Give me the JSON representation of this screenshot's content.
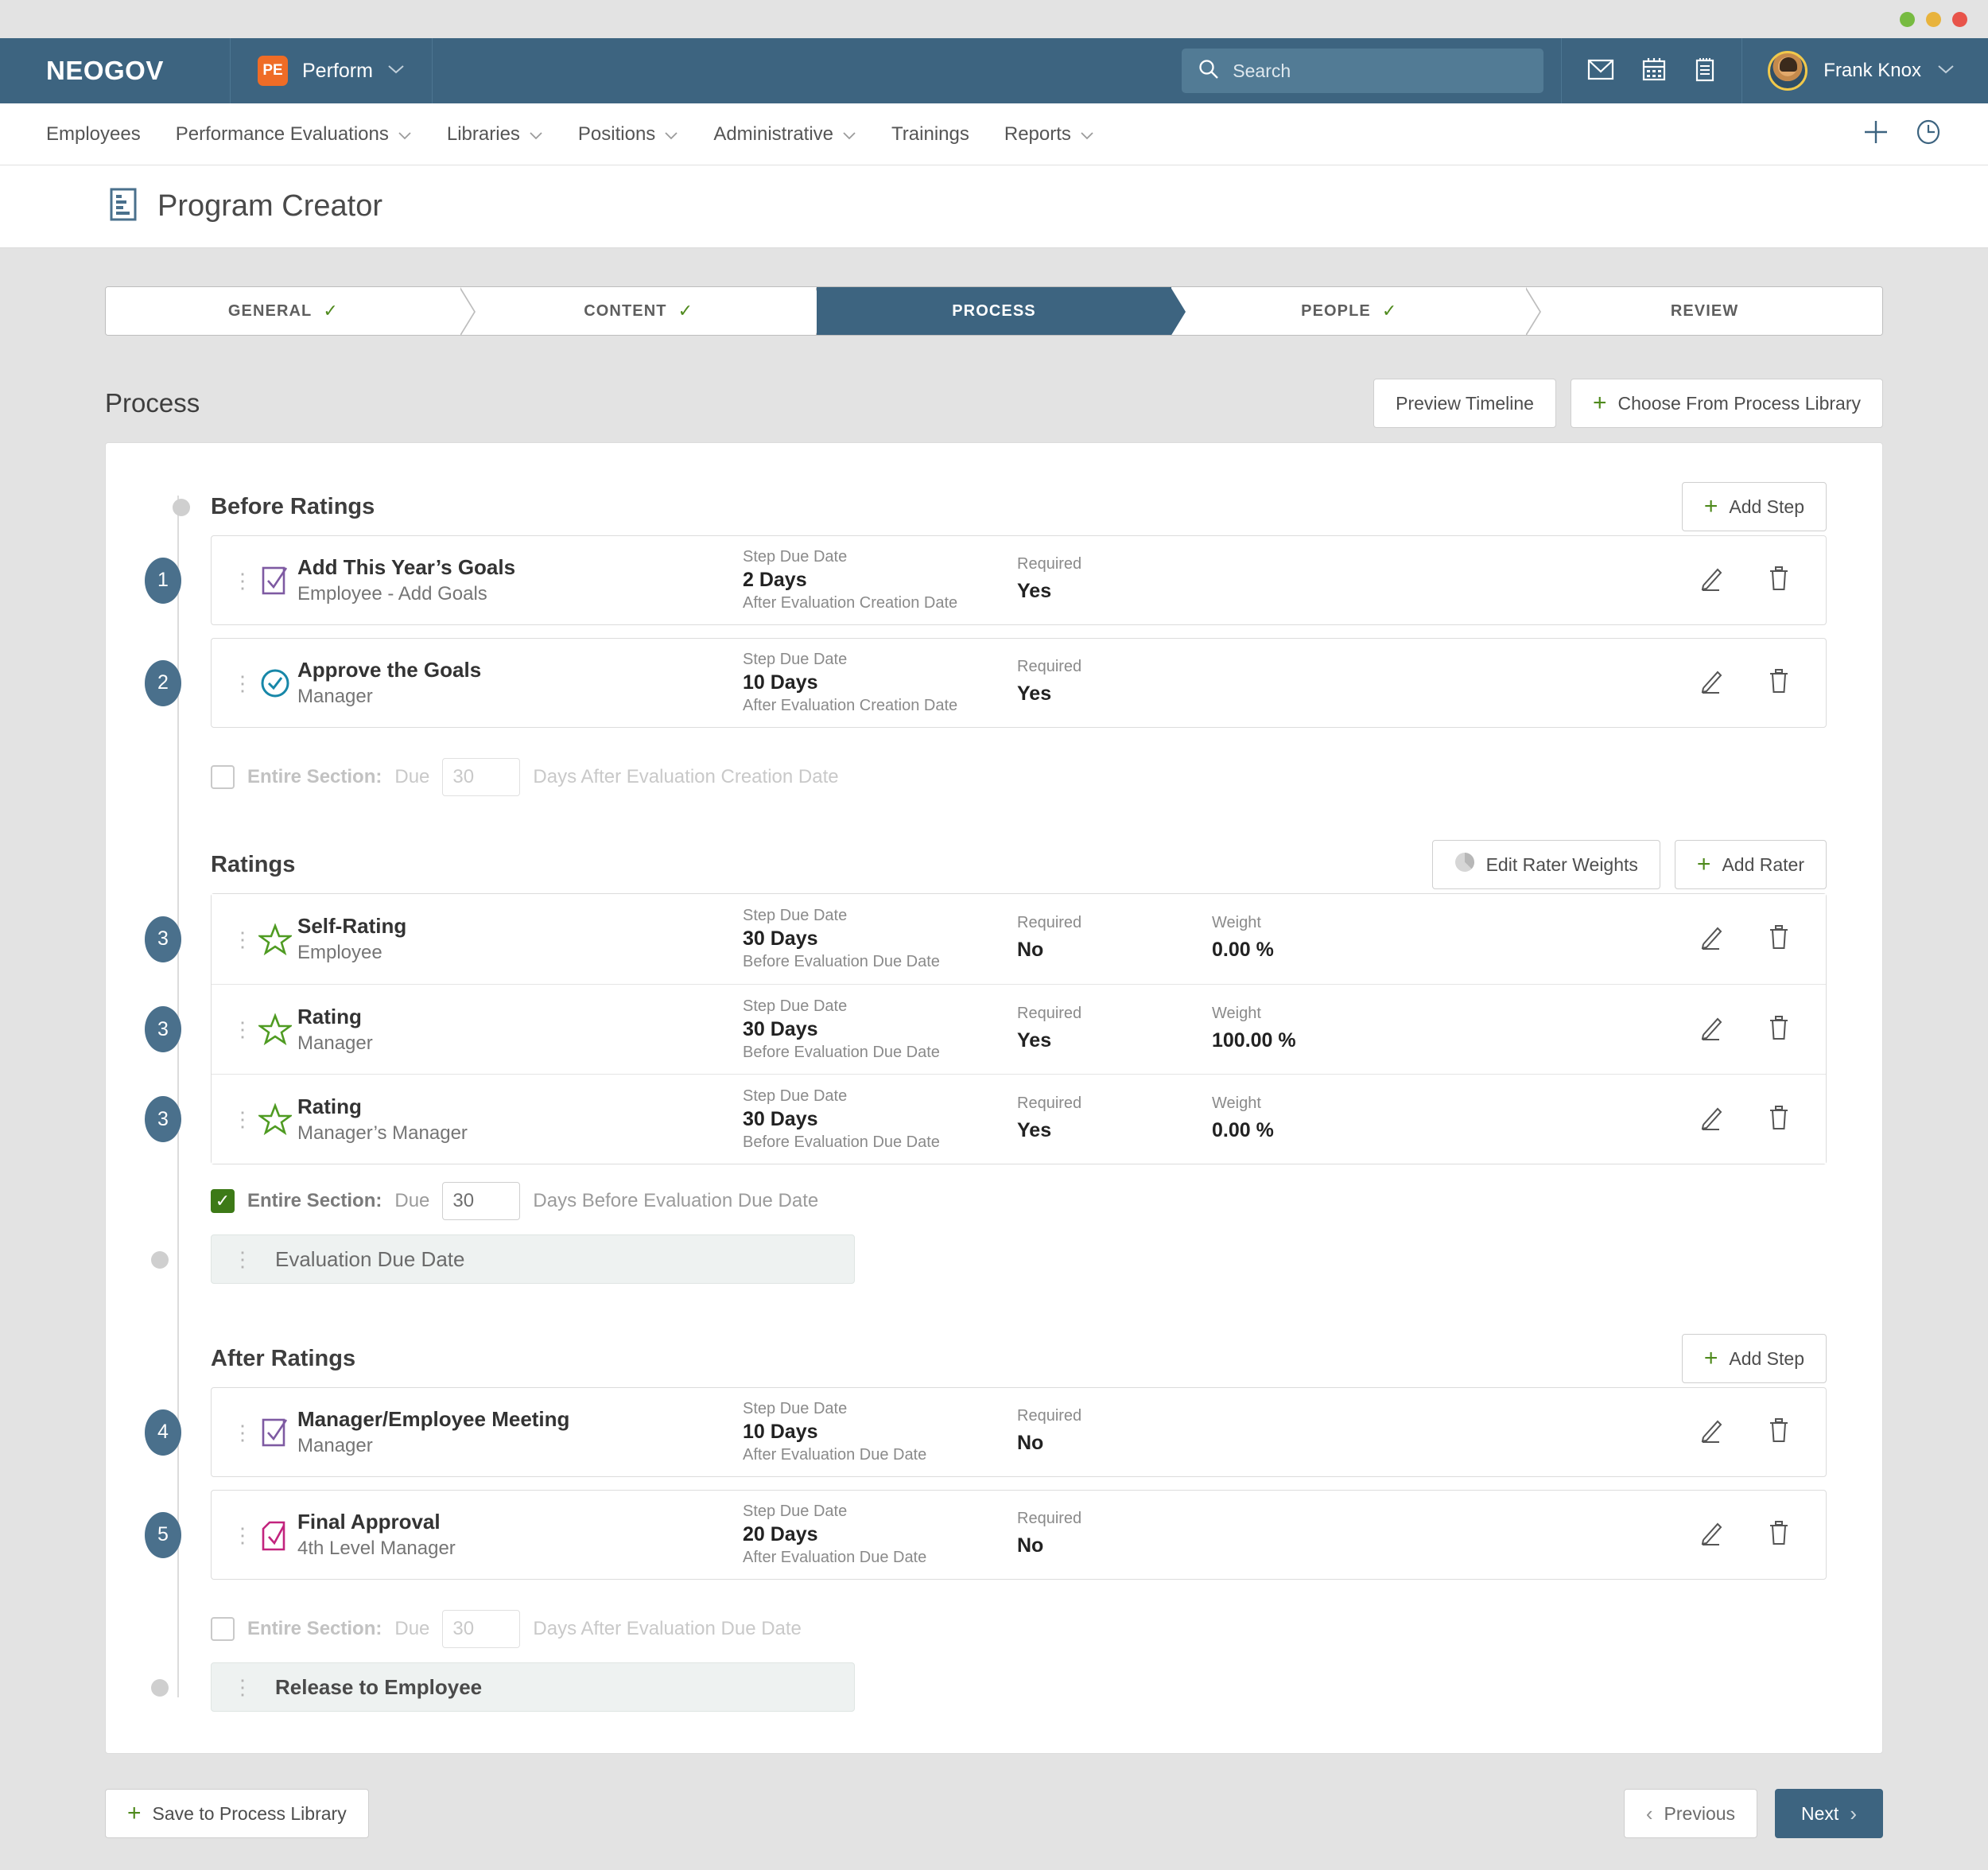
{
  "window": {
    "dots": [
      "green",
      "yellow",
      "red"
    ]
  },
  "topnav": {
    "brand": "NEOGOV",
    "app_badge": "PE",
    "app_name": "Perform",
    "search_placeholder": "Search",
    "search_value": "",
    "icons": [
      "envelope-icon",
      "calendar-icon",
      "notepad-icon"
    ],
    "user_name": "Frank Knox"
  },
  "subnav": {
    "items": [
      {
        "label": "Employees",
        "has_caret": false
      },
      {
        "label": "Performance Evaluations",
        "has_caret": true
      },
      {
        "label": "Libraries",
        "has_caret": true
      },
      {
        "label": "Positions",
        "has_caret": true
      },
      {
        "label": "Administrative",
        "has_caret": true
      },
      {
        "label": "Trainings",
        "has_caret": false
      },
      {
        "label": "Reports",
        "has_caret": true
      }
    ],
    "right_icons": [
      "plus-icon",
      "clock-icon"
    ]
  },
  "page": {
    "title": "Program Creator",
    "title_icon": "document-lines-icon"
  },
  "wizard": {
    "steps": [
      {
        "label": "GENERAL",
        "done": true,
        "active": false
      },
      {
        "label": "CONTENT",
        "done": true,
        "active": false
      },
      {
        "label": "PROCESS",
        "done": false,
        "active": true
      },
      {
        "label": "PEOPLE",
        "done": true,
        "active": false
      },
      {
        "label": "REVIEW",
        "done": false,
        "active": false
      }
    ]
  },
  "process": {
    "heading": "Process",
    "preview_timeline_label": "Preview Timeline",
    "choose_library_label": "Choose From Process Library",
    "sections": [
      {
        "title": "Before Ratings",
        "action_label": "Add Step",
        "steps": [
          {
            "badge": "1",
            "name": "Add This Year’s Goals",
            "role": "Employee - Add Goals",
            "icon": "checkbox-purple-icon",
            "due_label": "Step Due Date",
            "due_value": "2 Days",
            "due_sub": "After Evaluation Creation Date",
            "required_label": "Required",
            "required_value": "Yes"
          },
          {
            "badge": "2",
            "name": "Approve the Goals",
            "role": "Manager",
            "icon": "check-circle-teal-icon",
            "due_label": "Step Due Date",
            "due_value": "10 Days",
            "due_sub": "After Evaluation Creation Date",
            "required_label": "Required",
            "required_value": "Yes"
          }
        ],
        "entire_section": {
          "checked": false,
          "label": "Entire Section:",
          "due_word": "Due",
          "days": "30",
          "tail": "Days After Evaluation Creation Date"
        }
      },
      {
        "title": "Ratings",
        "edit_weights_label": "Edit Rater Weights",
        "add_rater_label": "Add Rater",
        "steps": [
          {
            "badge": "3",
            "name": "Self-Rating",
            "role": "Employee",
            "icon": "star-green-icon",
            "due_label": "Step Due Date",
            "due_value": "30 Days",
            "due_sub": "Before Evaluation Due Date",
            "required_label": "Required",
            "required_value": "No",
            "weight_label": "Weight",
            "weight_value": "0.00 %"
          },
          {
            "badge": "3",
            "name": "Rating",
            "role": "Manager",
            "icon": "star-green-icon",
            "due_label": "Step Due Date",
            "due_value": "30 Days",
            "due_sub": "Before Evaluation Due Date",
            "required_label": "Required",
            "required_value": "Yes",
            "weight_label": "Weight",
            "weight_value": "100.00 %"
          },
          {
            "badge": "3",
            "name": "Rating",
            "role": "Manager’s Manager",
            "icon": "star-green-icon",
            "due_label": "Step Due Date",
            "due_value": "30 Days",
            "due_sub": "Before Evaluation Due Date",
            "required_label": "Required",
            "required_value": "Yes",
            "weight_label": "Weight",
            "weight_value": "0.00 %"
          }
        ],
        "entire_section": {
          "checked": true,
          "label": "Entire Section:",
          "due_word": "Due",
          "days": "30",
          "tail": "Days Before Evaluation Due Date"
        },
        "milestone": "Evaluation Due Date"
      },
      {
        "title": "After Ratings",
        "action_label": "Add Step",
        "steps": [
          {
            "badge": "4",
            "name": "Manager/Employee Meeting",
            "role": "Manager",
            "icon": "checkbox-purple-icon",
            "due_label": "Step Due Date",
            "due_value": "10 Days",
            "due_sub": "After Evaluation Due Date",
            "required_label": "Required",
            "required_value": "No"
          },
          {
            "badge": "5",
            "name": "Final Approval",
            "role": "4th Level Manager",
            "icon": "checkbox-magenta-icon",
            "due_label": "Step Due Date",
            "due_value": "20 Days",
            "due_sub": "After Evaluation Due Date",
            "required_label": "Required",
            "required_value": "No"
          }
        ],
        "entire_section": {
          "checked": false,
          "label": "Entire Section:",
          "due_word": "Due",
          "days": "30",
          "tail": "Days After Evaluation Due Date"
        },
        "milestone": "Release to Employee"
      }
    ]
  },
  "footer": {
    "save_library_label": "Save to Process Library",
    "previous_label": "Previous",
    "next_label": "Next"
  },
  "colors": {
    "brand_navy": "#3d6480",
    "accent_orange": "#ef6c26",
    "green": "#4f8a1d",
    "checkbox_green": "#3d7a17",
    "badge_navy": "#4a708c",
    "purple": "#7e5aa2",
    "teal": "#1787a8",
    "magenta": "#c2247e"
  }
}
